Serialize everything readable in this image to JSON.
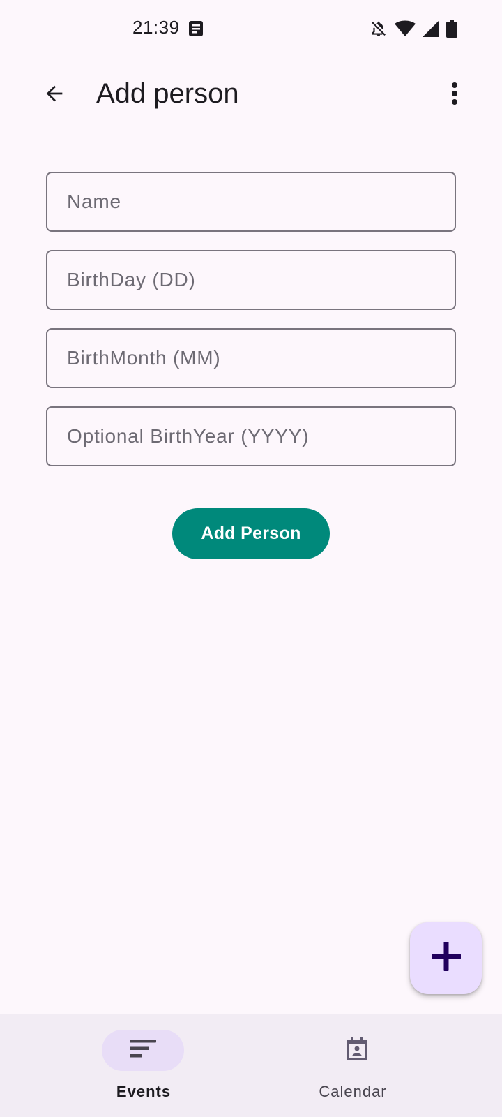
{
  "status_bar": {
    "time": "21:39",
    "icons": [
      "note-icon",
      "bell-off-icon",
      "wifi-icon",
      "signal-icon",
      "battery-icon"
    ]
  },
  "app_bar": {
    "title": "Add person",
    "back_icon": "arrow-back-icon",
    "menu_icon": "more-vert-icon"
  },
  "form": {
    "name_placeholder": "Name",
    "day_placeholder": "BirthDay (DD)",
    "month_placeholder": "BirthMonth (MM)",
    "year_placeholder": "Optional BirthYear (YYYY)",
    "name_value": "",
    "day_value": "",
    "month_value": "",
    "year_value": "",
    "submit_label": "Add Person"
  },
  "fab": {
    "icon": "plus-icon"
  },
  "bottom_nav": {
    "items": [
      {
        "label": "Events",
        "icon": "sort-lines-icon",
        "selected": true
      },
      {
        "label": "Calendar",
        "icon": "calendar-person-icon",
        "selected": false
      }
    ]
  },
  "colors": {
    "background": "#fdf7fc",
    "primary_button": "#00897b",
    "fab_bg": "#eaddff",
    "fab_icon": "#21005d",
    "nav_bg": "#f2ecf4",
    "nav_indicator": "#e8ddf7"
  }
}
